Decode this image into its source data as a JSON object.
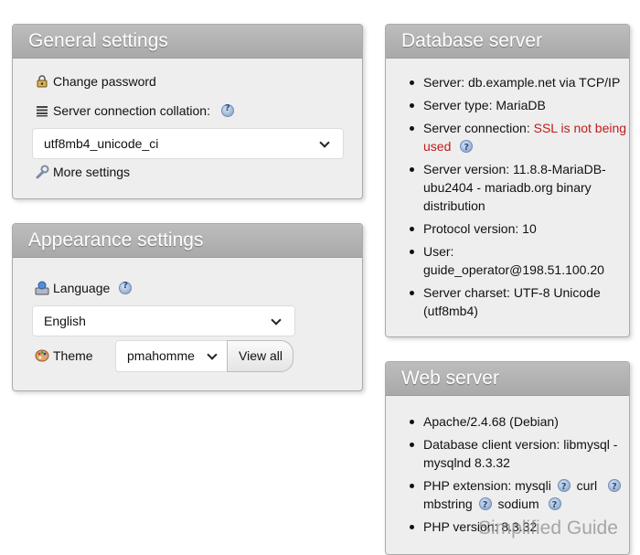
{
  "general": {
    "title": "General settings",
    "change_password": "Change password",
    "collation_label": "Server connection collation:",
    "collation_value": "utf8mb4_unicode_ci",
    "more_settings": "More settings"
  },
  "appearance": {
    "title": "Appearance settings",
    "language_label": "Language",
    "language_value": "English",
    "theme_label": "Theme",
    "theme_value": "pmahomme",
    "view_all": "View all"
  },
  "database": {
    "title": "Database server",
    "server": "Server: db.example.net via TCP/IP",
    "server_type": "Server type: MariaDB",
    "server_connection_label": "Server connection: ",
    "server_connection_status_1": "SSL is not being",
    "server_connection_status_2": "used",
    "server_version_1": "Server version: 11.8.8-MariaDB-",
    "server_version_2": "ubu2404 - mariadb.org binary",
    "server_version_3": "distribution",
    "protocol_version": "Protocol version: 10",
    "user_label": "User:",
    "user_value": "guide_operator@198.51.100.20",
    "charset_1": "Server charset: UTF-8 Unicode",
    "charset_2": "(utf8mb4)"
  },
  "web": {
    "title": "Web server",
    "apache": "Apache/2.4.68 (Debian)",
    "db_client_1": "Database client version: libmysql -",
    "db_client_2": "mysqlnd 8.3.32",
    "php_ext_label": "PHP extension: mysqli",
    "php_ext_curl": "curl",
    "php_ext_mbstring": "mbstring",
    "php_ext_sodium": "sodium",
    "php_version": "PHP version: 8.3.32"
  },
  "watermark": "Simplified Guide"
}
